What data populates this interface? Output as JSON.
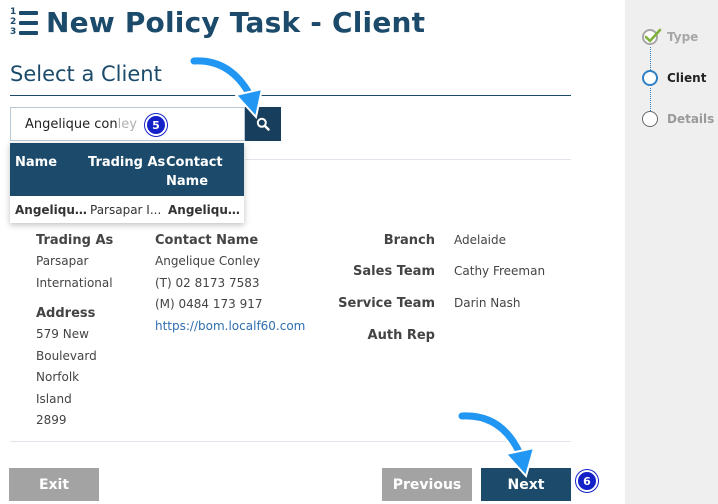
{
  "page": {
    "title": "New Policy Task - Client",
    "section_title": "Select a Client"
  },
  "search": {
    "typed_value": "Angelique con",
    "ghost_value": "ley",
    "button_icon": "search-icon"
  },
  "dropdown": {
    "columns": [
      "Name",
      "Trading As",
      "Contact Name"
    ],
    "rows": [
      [
        "Angelique ...",
        "Parsapar I...",
        "Angelique ..."
      ]
    ]
  },
  "client": {
    "trading_as_label": "Trading As",
    "trading_as_lines": [
      "Parsapar",
      "International"
    ],
    "address_label": "Address",
    "address_lines": [
      "579 New",
      "Boulevard",
      "Norfolk",
      "Island",
      "2899"
    ],
    "contact_label": "Contact Name",
    "contact_name": "Angelique Conley",
    "contact_phone": "(T) 02 8173 7583",
    "contact_mobile": "(M) 0484 173 917",
    "contact_url": "https://bom.localf60.com",
    "branch_label": "Branch",
    "branch_value": "Adelaide",
    "sales_team_label": "Sales Team",
    "sales_team_value": "Cathy Freeman",
    "service_team_label": "Service Team",
    "service_team_value": "Darin Nash",
    "auth_rep_label": "Auth Rep"
  },
  "buttons": {
    "exit": "Exit",
    "previous": "Previous",
    "next": "Next"
  },
  "wizard": {
    "steps": [
      {
        "label": "Type",
        "state": "complete"
      },
      {
        "label": "Client",
        "state": "current"
      },
      {
        "label": "Details",
        "state": "pending"
      }
    ]
  },
  "annotations": {
    "badge_search": "5",
    "badge_next": "6"
  },
  "colors": {
    "brand": "#1b4a6b",
    "annotation": "#1421c8",
    "annotation_arrow": "#2196f3"
  }
}
